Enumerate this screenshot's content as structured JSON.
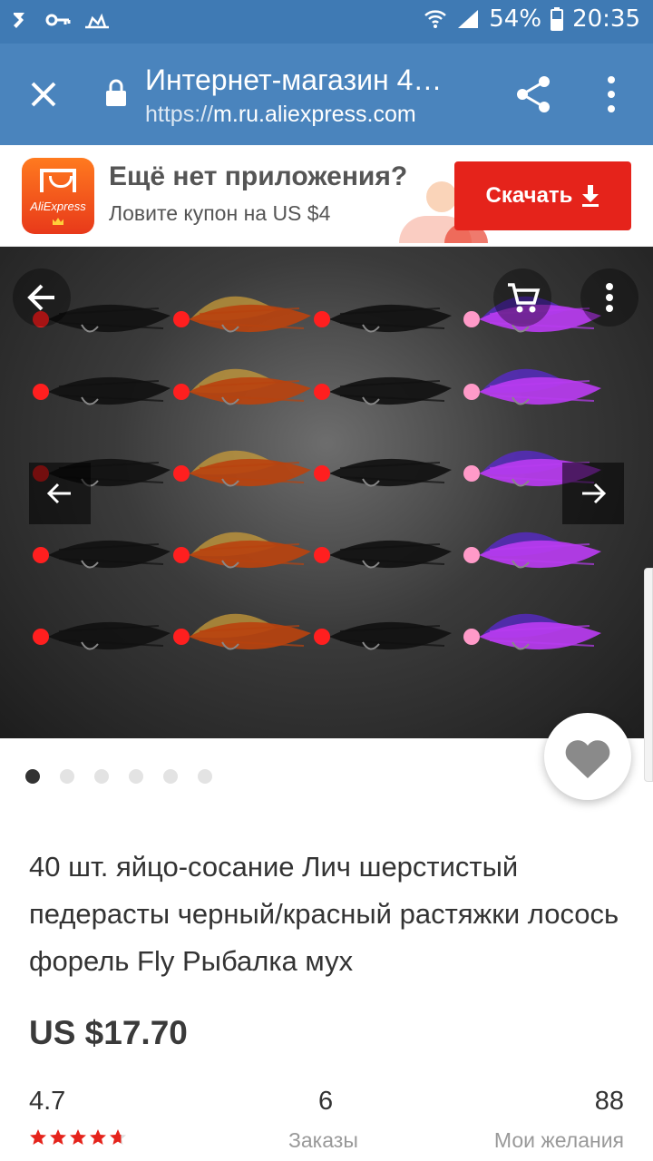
{
  "status_bar": {
    "battery": "54%",
    "time": "20:35"
  },
  "browser": {
    "page_title": "Интернет-магазин 4…",
    "url_scheme": "https://",
    "url_host": "m.ru.aliexpress.com"
  },
  "app_banner": {
    "logo_text": "AliExpress",
    "headline": "Ещё нет приложения?",
    "subline": "Ловите купон на US $4",
    "download_label": "Скачать"
  },
  "gallery": {
    "slide_count": 6,
    "active_slide": 1
  },
  "product": {
    "title": "40 шт. яйцо-сосание Лич шерстистый педерасты черный/красный растяжки лосось форель Fly Рыбалка мух",
    "price": "US $17.70"
  },
  "stats": {
    "rating": "4.7",
    "rating_stars": 4.7,
    "orders_count": "6",
    "orders_label": "Заказы",
    "wishlist_count": "88",
    "wishlist_label": "Мои желания"
  },
  "colors": {
    "status_bar": "#3f7ab4",
    "toolbar": "#4a84bd",
    "download_button": "#e5231b",
    "star": "#e5231b"
  }
}
